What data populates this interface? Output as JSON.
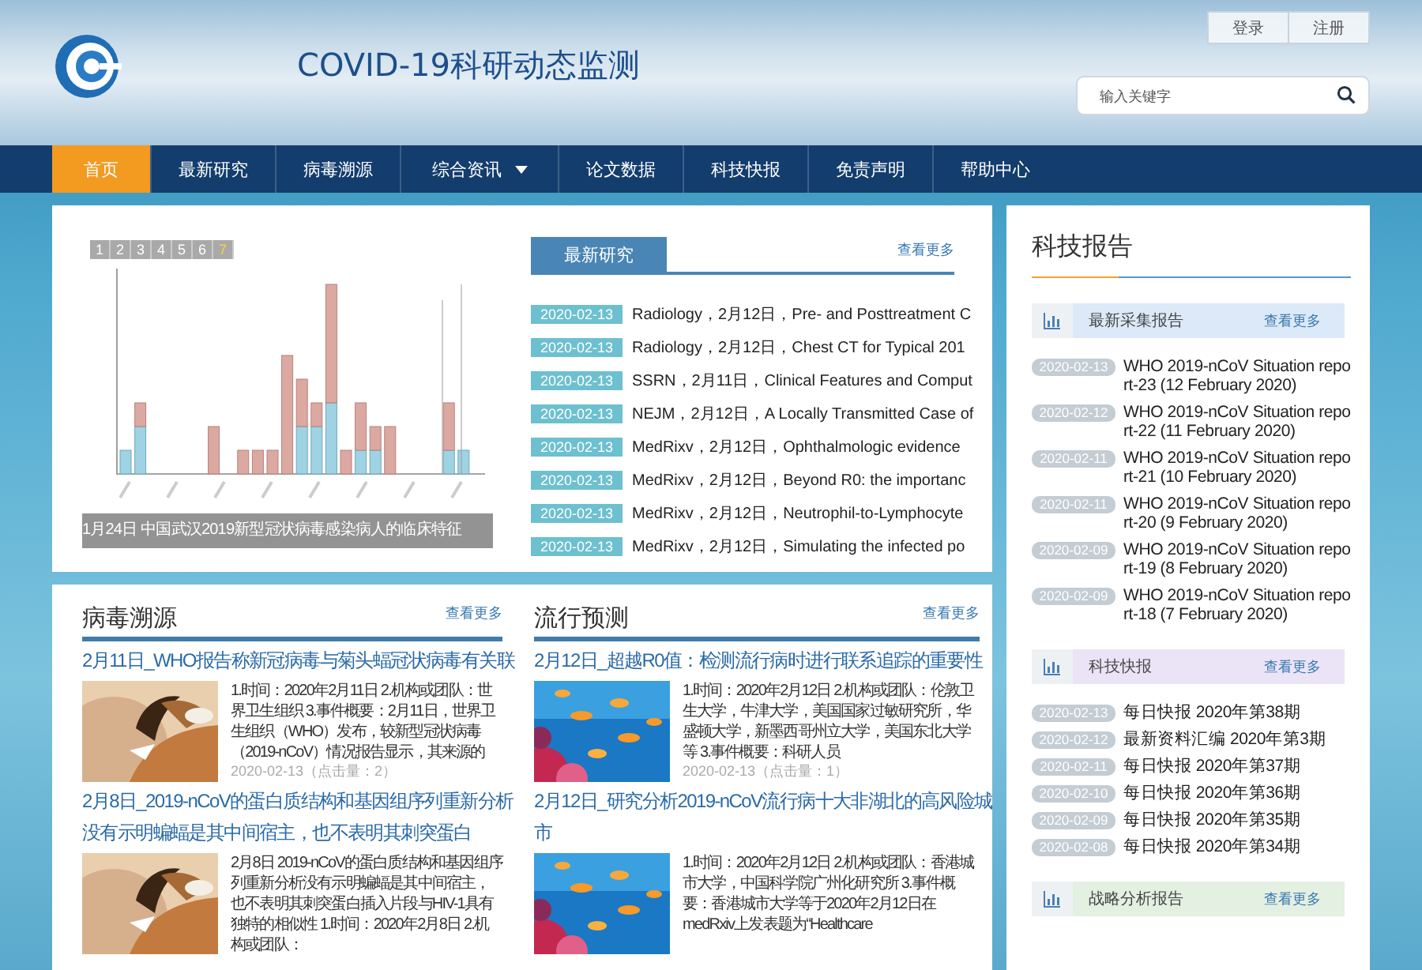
{
  "header": {
    "title": "COVID-19科研动态监测",
    "account_links": [
      "登录",
      "注册"
    ],
    "search": {
      "placeholder": "输入关键字"
    }
  },
  "nav": [
    {
      "label": "首页",
      "selected": true,
      "dropdown": false
    },
    {
      "label": "最新研究",
      "selected": false,
      "dropdown": false
    },
    {
      "label": "病毒溯源",
      "selected": false,
      "dropdown": false
    },
    {
      "label": "综合资讯",
      "selected": false,
      "dropdown": true
    },
    {
      "label": "论文数据",
      "selected": false,
      "dropdown": false
    },
    {
      "label": "科技快报",
      "selected": false,
      "dropdown": false
    },
    {
      "label": "免责声明",
      "selected": false,
      "dropdown": false
    },
    {
      "label": "帮助中心",
      "selected": false,
      "dropdown": false
    }
  ],
  "slideshow": {
    "pages": [
      {
        "label": "1",
        "selected": false
      },
      {
        "label": "2",
        "selected": false
      },
      {
        "label": "3",
        "selected": false
      },
      {
        "label": "4",
        "selected": false
      },
      {
        "label": "5",
        "selected": false
      },
      {
        "label": "6",
        "selected": false
      },
      {
        "label": "7",
        "selected": true
      }
    ],
    "caption": "1月24日  中国武汉2019新型冠状病毒感染病人的临床特征"
  },
  "latest": {
    "tab": "最新研究",
    "more": "查看更多",
    "items": [
      {
        "date": "2020-02-13",
        "text": "Radiology，2月12日，Pre- and Posttreatment C"
      },
      {
        "date": "2020-02-13",
        "text": "Radiology，2月12日，Chest CT for Typical 201"
      },
      {
        "date": "2020-02-13",
        "text": "SSRN，2月11日，Clinical Features and Comput"
      },
      {
        "date": "2020-02-13",
        "text": "NEJM，2月12日，A Locally Transmitted Case of"
      },
      {
        "date": "2020-02-13",
        "text": "MedRixv，2月12日，Ophthalmologic evidence"
      },
      {
        "date": "2020-02-13",
        "text": "MedRixv，2月12日，Beyond R0: the importanc"
      },
      {
        "date": "2020-02-13",
        "text": "MedRixv，2月12日，Neutrophil-to-Lymphocyte"
      },
      {
        "date": "2020-02-13",
        "text": "MedRixv，2月12日，Simulating the infected po"
      }
    ]
  },
  "sections": [
    {
      "title": "病毒溯源",
      "more": "查看更多",
      "articles": [
        {
          "title": "2月11日_WHO报告称新冠病毒与菊头蝠冠状病毒有关联",
          "summary": "1.时间：2020年2月11日 2.机构或团队：世界卫生组织 3.事件概要：2月11日，世界卫生组织（WHO）发布，较新型冠状病毒（2019-nCoV）情况报告显示，其来源的",
          "meta": "2020-02-13（点击量：2）"
        },
        {
          "title": "2月8日_2019-nCoV的蛋白质结构和基因组序列重新分析没有示明蝙蝠是其中间宿主，也不表明其刺突蛋白",
          "summary": "2月8日 2019-nCoV的蛋白质结构和基因组序列重新分析没有示明蝙蝠是其中间宿主，也不表明其刺突蛋白插入片段与HIV-1具有独特的相似性 1.时间：2020年2月8日 2.机构或团队："
        }
      ]
    },
    {
      "title": "流行预测",
      "more": "查看更多",
      "articles": [
        {
          "title": "2月12日_超越R0值：检测流行病时进行联系追踪的重要性",
          "summary": "1.时间：2020年2月12日 2.机构或团队：伦敦卫生大学，牛津大学，美国国家过敏研究所，华盛顿大学，新墨西哥州立大学，美国东北大学等 3.事件概要：科研人员",
          "meta": "2020-02-13（点击量：1）"
        },
        {
          "title": "2月12日_研究分析2019-nCoV流行病十大非湖北的高风险城市",
          "summary": "1.时间：2020年2月12日 2.机构或团队：香港城市大学，中国科学院广州化研究所 3.事件概要：香港城市大学等于2020年2月12日在medRxiv上发表题为“Healthcare"
        }
      ]
    }
  ],
  "reports": {
    "title": "科技报告",
    "groups": [
      {
        "title": "最新采集报告",
        "more": "查看更多",
        "color": "#dce9f8",
        "items": [
          {
            "date": "2020-02-13",
            "text": "WHO 2019-nCoV Situation report-23 (12 February 2020)"
          },
          {
            "date": "2020-02-12",
            "text": "WHO 2019-nCoV Situation report-22 (11 February 2020)"
          },
          {
            "date": "2020-02-11",
            "text": "WHO 2019-nCoV Situation report-21 (10 February 2020)"
          },
          {
            "date": "2020-02-11",
            "text": "WHO 2019-nCoV Situation report-20 (9 February 2020)"
          },
          {
            "date": "2020-02-09",
            "text": "WHO 2019-nCoV Situation report-19 (8 February 2020)"
          },
          {
            "date": "2020-02-09",
            "text": "WHO 2019-nCoV Situation report-18 (7 February 2020)"
          }
        ]
      },
      {
        "title": "科技快报",
        "more": "查看更多",
        "color": "#ebe4f7",
        "items": [
          {
            "date": "2020-02-13",
            "text": "每日快报 2020年第38期"
          },
          {
            "date": "2020-02-12",
            "text": "最新资料汇编 2020年第3期"
          },
          {
            "date": "2020-02-11",
            "text": "每日快报 2020年第37期"
          },
          {
            "date": "2020-02-10",
            "text": "每日快报 2020年第36期"
          },
          {
            "date": "2020-02-09",
            "text": "每日快报 2020年第35期"
          },
          {
            "date": "2020-02-08",
            "text": "每日快报 2020年第34期"
          }
        ]
      },
      {
        "title": "战略分析报告",
        "more": "查看更多",
        "color": "#e3f0e2"
      }
    ]
  }
}
